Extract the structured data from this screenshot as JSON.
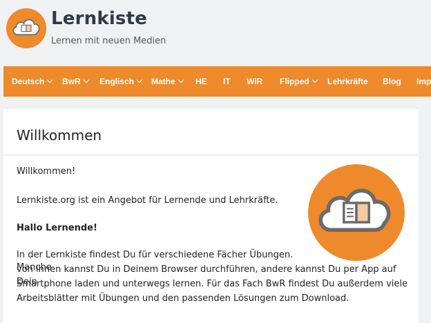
{
  "site": {
    "title": "Lernkiste",
    "tagline": "Lernen mit neuen Medien"
  },
  "nav": {
    "items": [
      {
        "label": "Deutsch",
        "has_dropdown": true
      },
      {
        "label": "BwR",
        "has_dropdown": true
      },
      {
        "label": "Englisch",
        "has_dropdown": true
      },
      {
        "label": "Mathe",
        "has_dropdown": true
      },
      {
        "label": "HE",
        "has_dropdown": false
      },
      {
        "label": "IT",
        "has_dropdown": false
      },
      {
        "label": "WiR",
        "has_dropdown": false
      },
      {
        "label": "Flipped",
        "has_dropdown": true
      },
      {
        "label": "Lehrkräfte",
        "has_dropdown": false
      },
      {
        "label": "Blog",
        "has_dropdown": false
      },
      {
        "label": "Imp",
        "has_dropdown": false
      }
    ]
  },
  "article": {
    "title": "Willkommen",
    "p1": "Willkommen!",
    "p2": "Lernkiste.org ist ein Angebot für Lernende und Lehrkräfte.",
    "p3": "Hallo Lernende!",
    "p4_line1": "In der Lernkiste findest Du für verschiedene Fächer Übungen. Manche",
    "p4_line2": "von ihnen kannst Du in Deinem Browser durchführen, andere kannst Du per App auf Dein",
    "p4_line3": "Smartphone laden und unterwegs lernen. Für das Fach BwR findest Du außerdem viele",
    "p4_line4": "Arbeitsblätter mit Übungen und den passenden Lösungen zum Download."
  },
  "colors": {
    "accent": "#ee8a2b",
    "background": "#eff1f3",
    "card": "#ffffff",
    "title": "#2f3a44"
  }
}
